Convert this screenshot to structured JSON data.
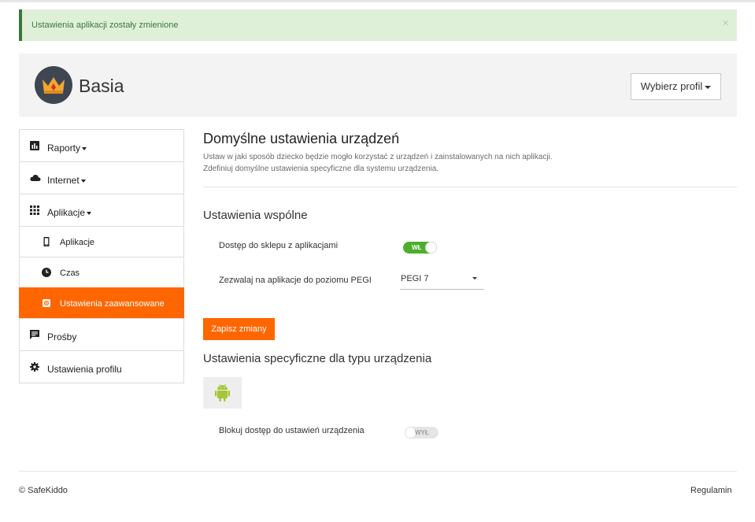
{
  "alert": {
    "message": "Ustawienia aplikacji zostały zmienione",
    "close_symbol": "×"
  },
  "profile": {
    "name": "Basia",
    "switch_button_label": "Wybierz profil",
    "avatar_icon": "crown-icon"
  },
  "sidebar": {
    "items": [
      {
        "label": "Raporty",
        "icon": "bar-chart-icon",
        "has_dropdown": true
      },
      {
        "label": "Internet",
        "icon": "cloud-icon",
        "has_dropdown": true
      },
      {
        "label": "Aplikacje",
        "icon": "grid-icon",
        "has_dropdown": true
      },
      {
        "label": "Aplikacje",
        "icon": "phone-icon",
        "sub": true
      },
      {
        "label": "Czas",
        "icon": "clock-icon",
        "sub": true
      },
      {
        "label": "Ustawienia zaawansowane",
        "icon": "gear-icon",
        "sub": true,
        "active": true
      },
      {
        "label": "Prośby",
        "icon": "message-icon"
      },
      {
        "label": "Ustawienia profilu",
        "icon": "gear-icon"
      }
    ]
  },
  "main": {
    "title": "Domyślne ustawienia urządzeń",
    "description_line1": "Ustaw w jaki sposób dziecko będzie mogło korzystać z urządzeń i zainstalowanych na nich aplikacji.",
    "description_line2": "Zdefiniuj domyślne ustawienia specyficzne dla systemu urządzenia.",
    "common_section": {
      "title": "Ustawienia wspólne",
      "store_access_label": "Dostęp do sklepu z aplikacjami",
      "store_access_toggle": "WŁ",
      "store_access_on": true,
      "pegi_label": "Zezwalaj na aplikacje do poziomu PEGI",
      "pegi_value": "PEGI 7"
    },
    "save_button": "Zapisz zmiany",
    "device_section": {
      "title": "Ustawienia specyficzne dla typu urządzenia",
      "platform_icon": "android-icon",
      "block_settings_label": "Blokuj dostęp do ustawień urządzenia",
      "block_settings_toggle": "WYŁ",
      "block_settings_on": false
    }
  },
  "footer": {
    "copyright": "© SafeKiddo",
    "terms_link": "Regulamin"
  },
  "colors": {
    "accent": "#ff6600",
    "toggle_on": "#4caf2b",
    "alert_bg": "#dff0d8",
    "alert_text": "#3c763d",
    "android_green": "#a4c639"
  }
}
